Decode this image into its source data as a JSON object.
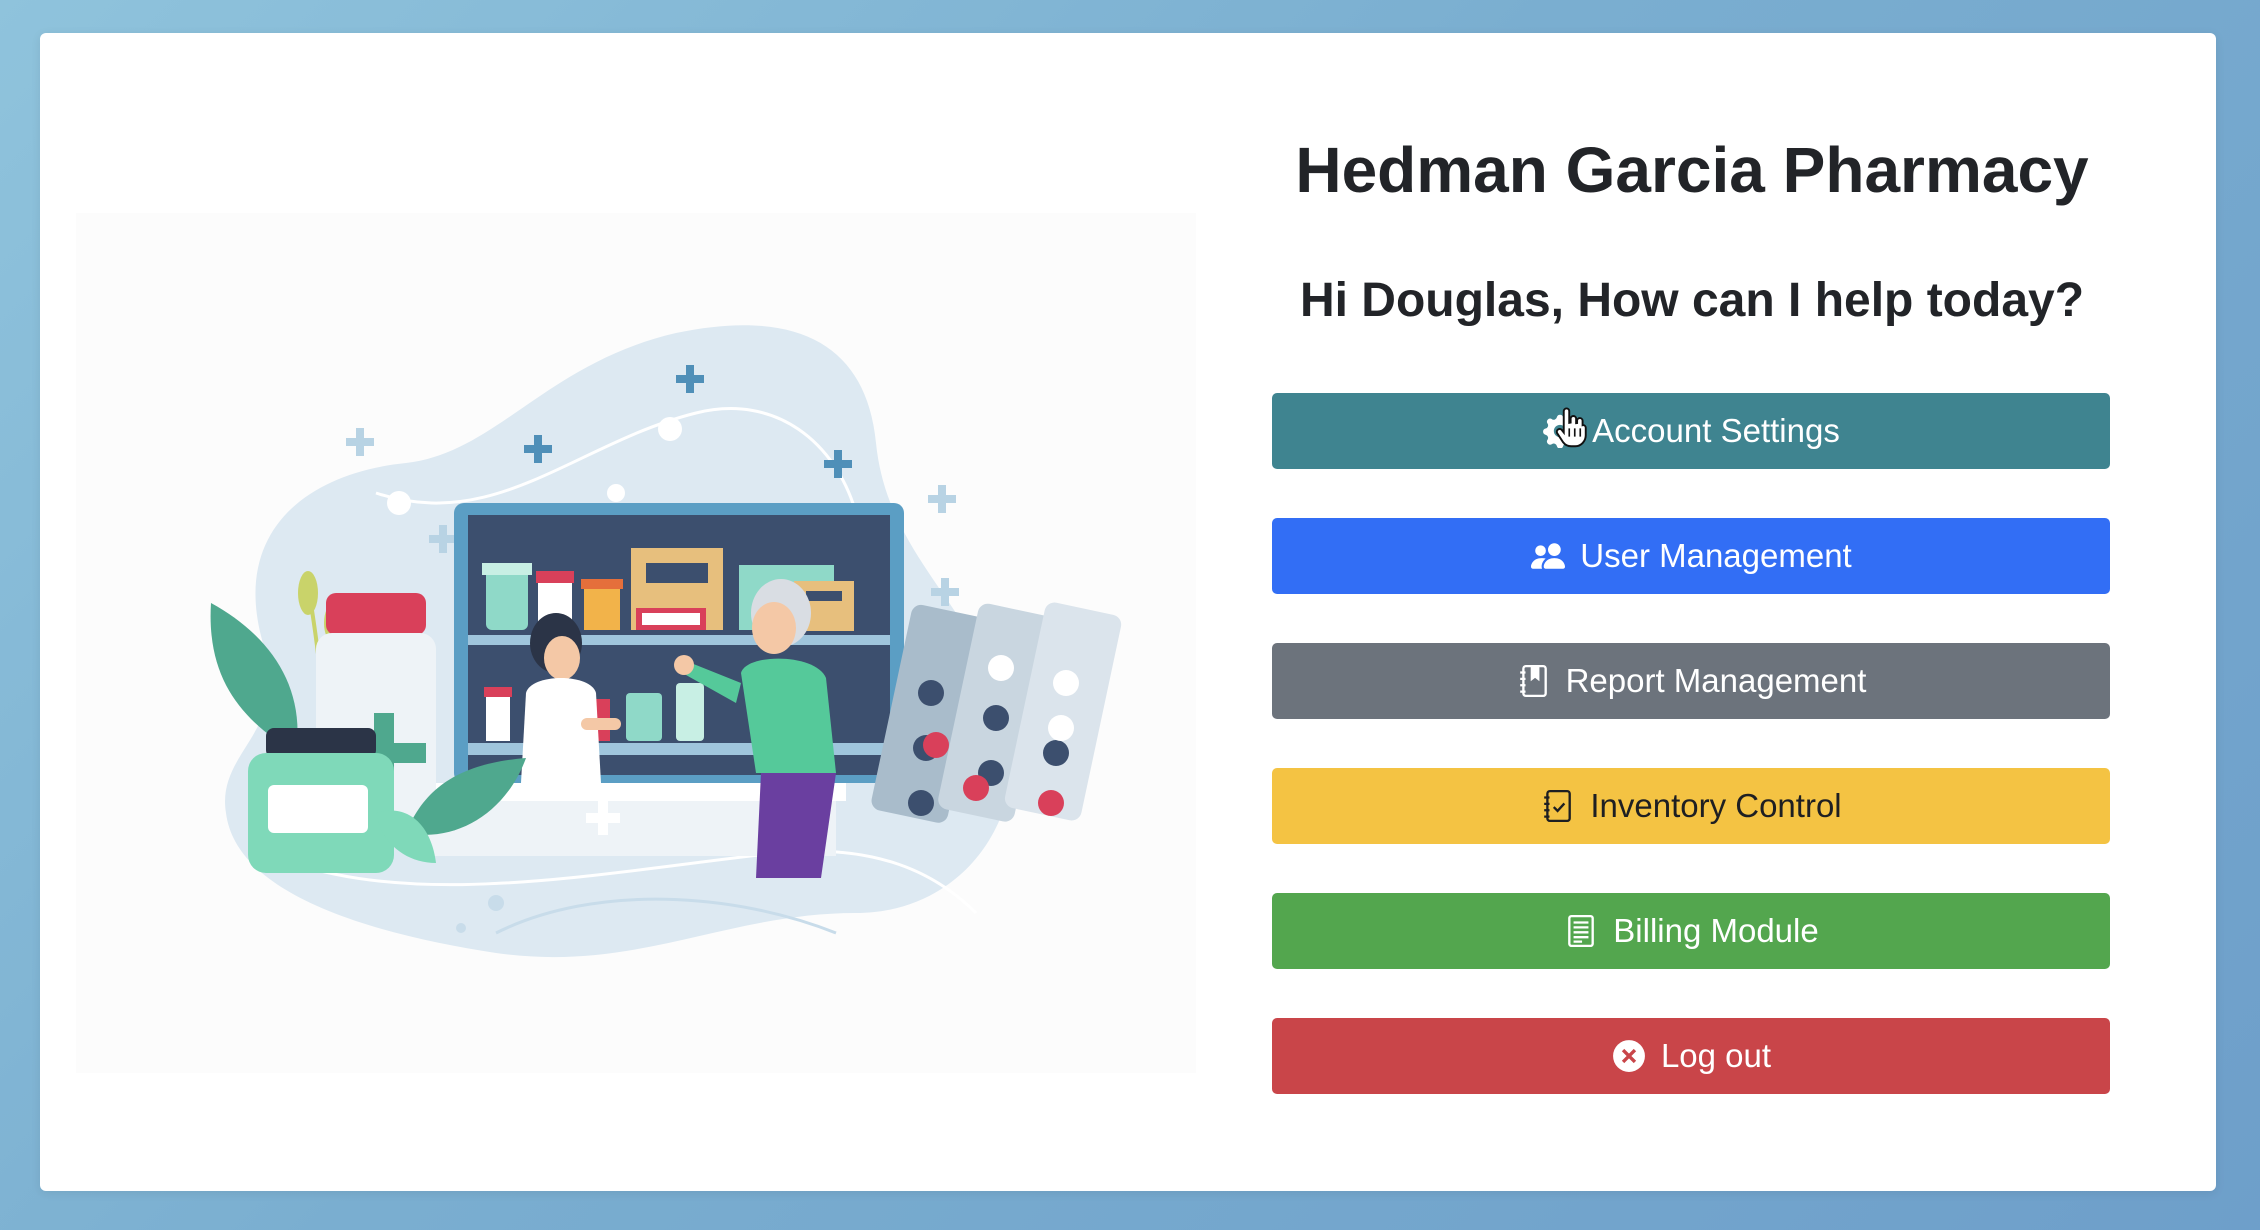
{
  "app": {
    "title": "Hedman Garcia Pharmacy",
    "greeting": "Hi Douglas, How can I help today?"
  },
  "menu": {
    "account_settings": "Account Settings",
    "user_management": "User Management",
    "report_management": "Report Management",
    "inventory_control": "Inventory Control",
    "billing_module": "Billing Module",
    "log_out": "Log out"
  },
  "icons": {
    "account_settings": "gear-icon",
    "user_management": "people-icon",
    "report_management": "journal-bookmark-icon",
    "inventory_control": "clipboard-check-icon",
    "billing_module": "receipt-icon",
    "log_out": "x-circle-icon",
    "cursor": "hand-pointer-icon"
  },
  "colors": {
    "account_settings": "#3f8490",
    "user_management": "#326ef5",
    "report_management": "#6c737c",
    "inventory_control": "#f4c343",
    "billing_module": "#53a64e",
    "log_out": "#c94549"
  }
}
